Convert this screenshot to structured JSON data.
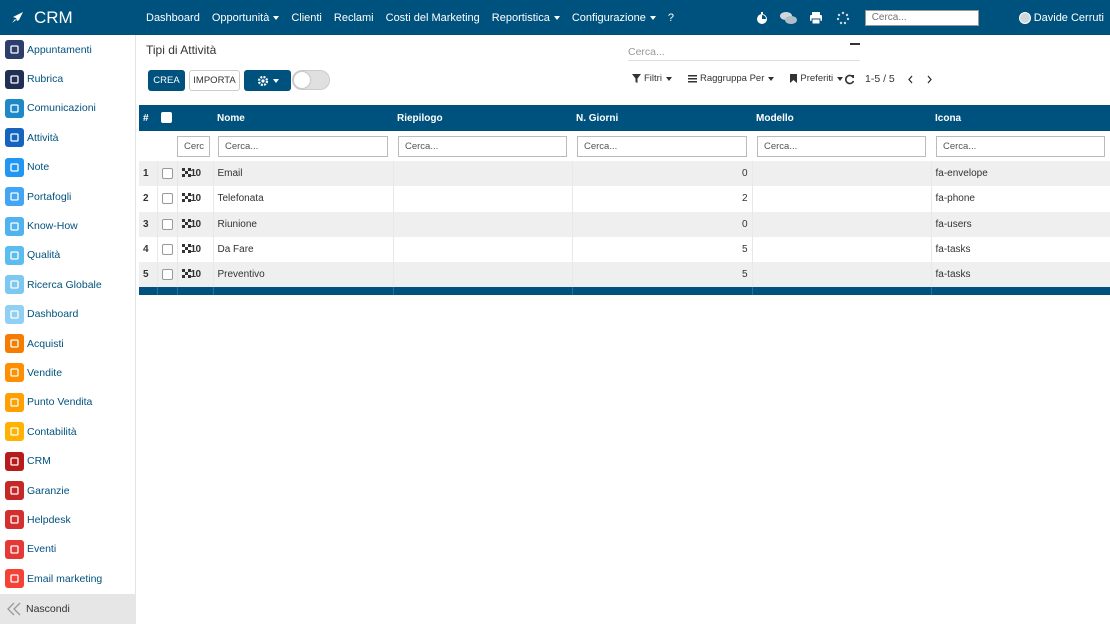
{
  "navbar": {
    "brand": "CRM",
    "menu": [
      {
        "label": "Dashboard",
        "dropdown": false
      },
      {
        "label": "Opportunità",
        "dropdown": true
      },
      {
        "label": "Clienti",
        "dropdown": false
      },
      {
        "label": "Reclami",
        "dropdown": false
      },
      {
        "label": "Costi del Marketing",
        "dropdown": false
      },
      {
        "label": "Reportistica",
        "dropdown": true
      },
      {
        "label": "Configurazione",
        "dropdown": true
      },
      {
        "label": "?",
        "dropdown": false
      }
    ],
    "search_placeholder": "Cerca...",
    "user_name": "Davide Cerruti"
  },
  "sidebar": {
    "items": [
      {
        "label": "Appuntamenti",
        "color": "#2c3e6b",
        "icon": "calendar-icon"
      },
      {
        "label": "Rubrica",
        "color": "#1f2f55",
        "icon": "contacts-icon"
      },
      {
        "label": "Comunicazioni",
        "color": "#1e88c8",
        "icon": "chat-icon"
      },
      {
        "label": "Attività",
        "color": "#1565c0",
        "icon": "check-icon"
      },
      {
        "label": "Note",
        "color": "#2196f3",
        "icon": "note-icon"
      },
      {
        "label": "Portafogli",
        "color": "#42a5f5",
        "icon": "lock-icon"
      },
      {
        "label": "Know-How",
        "color": "#4fb3f0",
        "icon": "lightbulb-icon"
      },
      {
        "label": "Qualità",
        "color": "#5bbcf0",
        "icon": "quality-icon"
      },
      {
        "label": "Ricerca Globale",
        "color": "#7cc8f2",
        "icon": "search-icon"
      },
      {
        "label": "Dashboard",
        "color": "#90d0f4",
        "icon": "dashboard-icon"
      },
      {
        "label": "Acquisti",
        "color": "#f57c00",
        "icon": "purchases-icon"
      },
      {
        "label": "Vendite",
        "color": "#ff8f00",
        "icon": "chart-icon"
      },
      {
        "label": "Punto Vendita",
        "color": "#ffa000",
        "icon": "pos-icon"
      },
      {
        "label": "Contabilità",
        "color": "#ffb300",
        "icon": "accounting-icon"
      },
      {
        "label": "CRM",
        "color": "#b71c1c",
        "icon": "handshake-icon"
      },
      {
        "label": "Garanzie",
        "color": "#c62828",
        "icon": "shield-icon"
      },
      {
        "label": "Helpdesk",
        "color": "#d32f2f",
        "icon": "headset-icon"
      },
      {
        "label": "Eventi",
        "color": "#e53935",
        "icon": "ticket-icon"
      },
      {
        "label": "Email marketing",
        "color": "#f44336",
        "icon": "paper-plane-icon"
      }
    ],
    "hide_label": "Nascondi"
  },
  "main": {
    "title": "Tipi di Attività",
    "search_placeholder": "Cerca...",
    "btn_create": "CREA",
    "btn_import": "IMPORTA",
    "filters_label": "Filtri",
    "groupby_label": "Raggruppa Per",
    "favorites_label": "Preferiti",
    "pager": "1-5 / 5"
  },
  "table": {
    "columns": {
      "index": "#",
      "name": "Nome",
      "summary": "Riepilogo",
      "days": "N. Giorni",
      "model": "Modello",
      "icon": "Icona"
    },
    "search_placeholder_short": "Cerc",
    "search_placeholder": "Cerca...",
    "handle_label": "10",
    "rows": [
      {
        "n": "1",
        "name": "Email",
        "summary": "",
        "days": "0",
        "model": "",
        "icon": "fa-envelope"
      },
      {
        "n": "2",
        "name": "Telefonata",
        "summary": "",
        "days": "2",
        "model": "",
        "icon": "fa-phone"
      },
      {
        "n": "3",
        "name": "Riunione",
        "summary": "",
        "days": "0",
        "model": "",
        "icon": "fa-users"
      },
      {
        "n": "4",
        "name": "Da Fare",
        "summary": "",
        "days": "5",
        "model": "",
        "icon": "fa-tasks"
      },
      {
        "n": "5",
        "name": "Preventivo",
        "summary": "",
        "days": "5",
        "model": "",
        "icon": "fa-tasks"
      }
    ]
  }
}
